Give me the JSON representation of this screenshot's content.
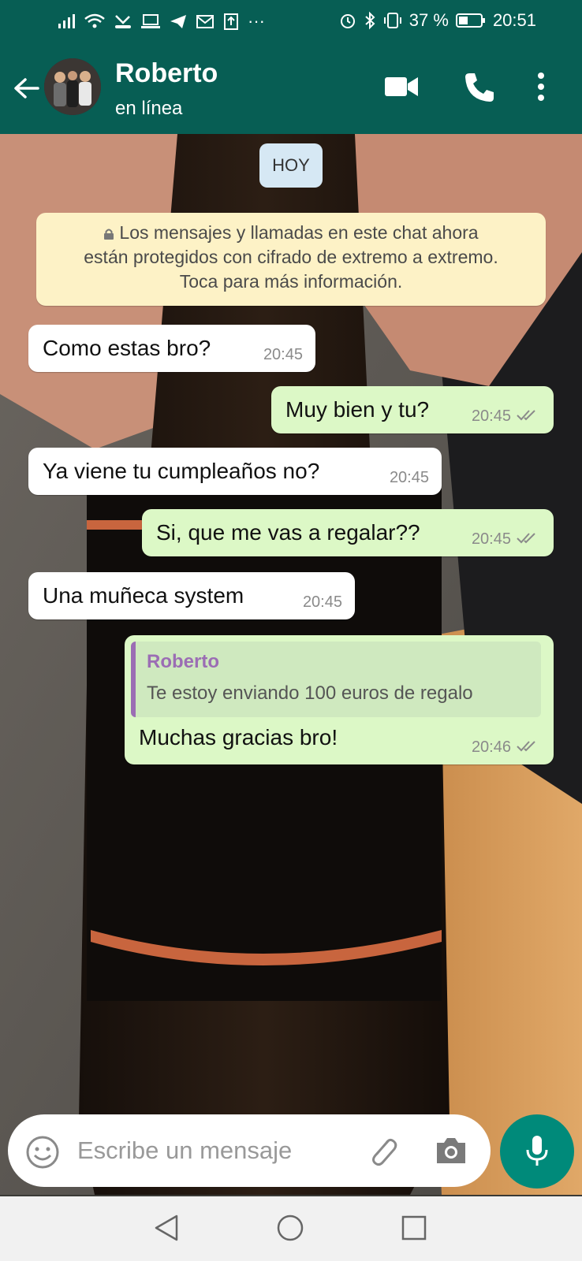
{
  "status_bar": {
    "battery_percent": "37 %",
    "time": "20:51",
    "more": "···"
  },
  "header": {
    "contact_name": "Roberto",
    "contact_status": "en línea"
  },
  "chat": {
    "date_chip": "HOY",
    "encryption_notice": {
      "line1": "Los mensajes y llamadas en este chat ahora",
      "line2": "están protegidos con cifrado de extremo a extremo.",
      "line3": "Toca para más información."
    },
    "messages": [
      {
        "direction": "incoming",
        "text": "Como estas bro?",
        "time": "20:45"
      },
      {
        "direction": "outgoing",
        "text": "Muy bien y tu?",
        "time": "20:45",
        "status": "read"
      },
      {
        "direction": "incoming",
        "text": "Ya viene tu cumpleaños no?",
        "time": "20:45"
      },
      {
        "direction": "outgoing",
        "text": "Si, que me vas a regalar??",
        "time": "20:45",
        "status": "read"
      },
      {
        "direction": "incoming",
        "text": "Una muñeca system",
        "time": "20:45"
      },
      {
        "direction": "outgoing",
        "text": "Muchas gracias bro!",
        "time": "20:46",
        "status": "read",
        "quoted": {
          "author": "Roberto",
          "text": "Te estoy enviando 100 euros de regalo"
        }
      }
    ]
  },
  "composer": {
    "placeholder": "Escribe un mensaje"
  },
  "colors": {
    "header_bg": "#075e54",
    "outgoing_bubble": "#dcf8c6",
    "incoming_bubble": "#ffffff",
    "mic_button": "#008a7a",
    "quote_accent": "#9b6db4"
  },
  "icons": [
    "back-arrow-icon",
    "video-call-icon",
    "phone-icon",
    "more-vert-icon",
    "lock-icon",
    "read-ticks-icon",
    "emoji-icon",
    "attach-icon",
    "camera-icon",
    "mic-icon",
    "nav-back-icon",
    "nav-home-icon",
    "nav-recents-icon"
  ]
}
